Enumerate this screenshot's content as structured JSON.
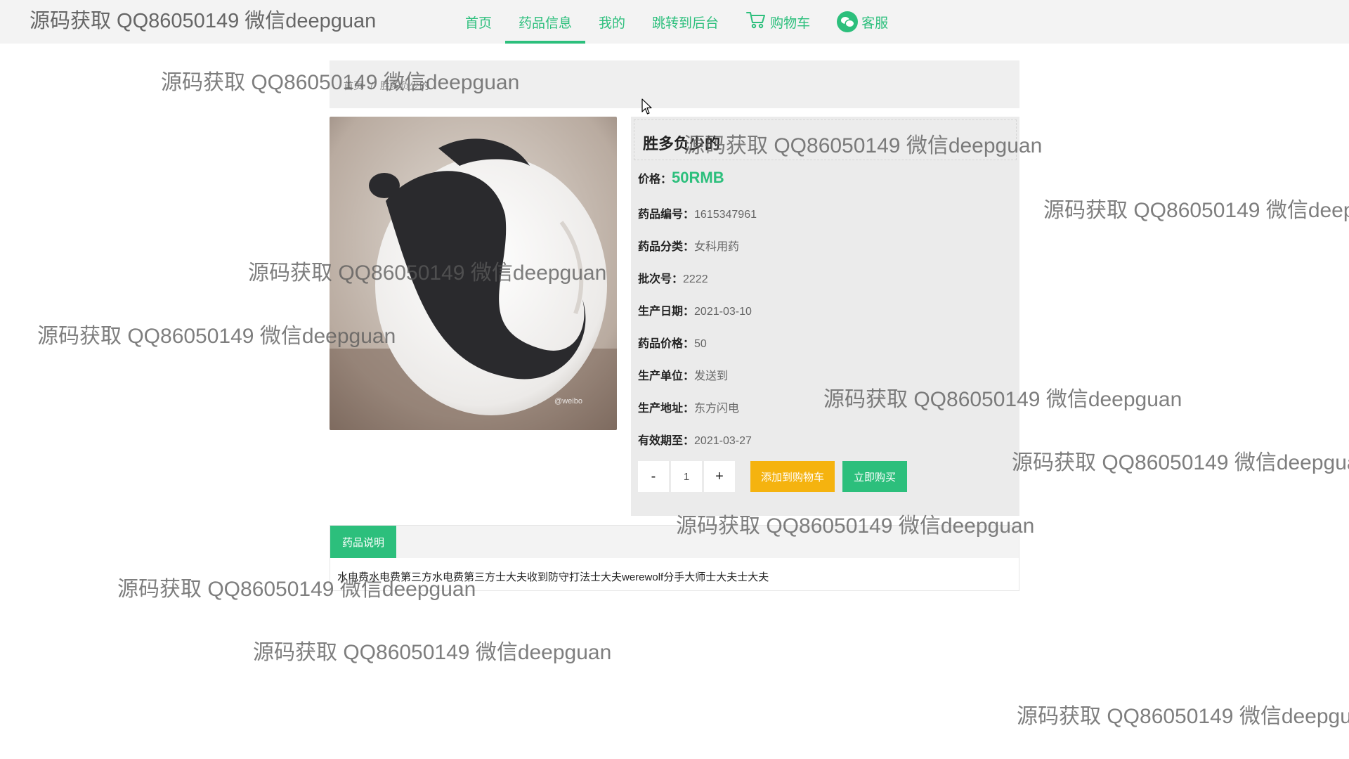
{
  "nav": {
    "logo_text": "源码获取 QQ86050149 微信deepguan",
    "items": [
      {
        "label": "首页",
        "active": false
      },
      {
        "label": "药品信息",
        "active": true
      },
      {
        "label": "我的",
        "active": false
      },
      {
        "label": "跳转到后台",
        "active": false
      },
      {
        "label": "购物车",
        "icon": "cart-icon",
        "active": false
      },
      {
        "label": "客服",
        "icon": "wechat-icon",
        "active": false
      }
    ]
  },
  "breadcrumb": {
    "home": "首页",
    "separator": "/",
    "current": "胜多负少的"
  },
  "product": {
    "image_icon": "panda-photo",
    "title": "胜多负少的",
    "price_label": "价格：",
    "price_value": "50RMB",
    "fields": [
      {
        "label": "药品编号：",
        "value": "1615347961"
      },
      {
        "label": "药品分类：",
        "value": "女科用药"
      },
      {
        "label": "批次号：",
        "value": "2222"
      },
      {
        "label": "生产日期：",
        "value": "2021-03-10"
      },
      {
        "label": "药品价格：",
        "value": "50"
      },
      {
        "label": "生产单位：",
        "value": "发送到"
      },
      {
        "label": "生产地址：",
        "value": "东方闪电"
      },
      {
        "label": "有效期至：",
        "value": "2021-03-27"
      }
    ],
    "quantity": "1",
    "minus_label": "-",
    "plus_label": "+",
    "add_to_cart_label": "添加到购物车",
    "buy_now_label": "立即购买"
  },
  "description": {
    "tab_label": "药品说明",
    "text": "水电费水电费第三方水电费第三方士大夫收到防守打法士大夫werewolf分手大师士大夫士大夫"
  },
  "watermark_text": "源码获取 QQ86050149 微信deepguan",
  "colors": {
    "accent": "#2cbf7c",
    "cart_button": "#f5b30f"
  }
}
